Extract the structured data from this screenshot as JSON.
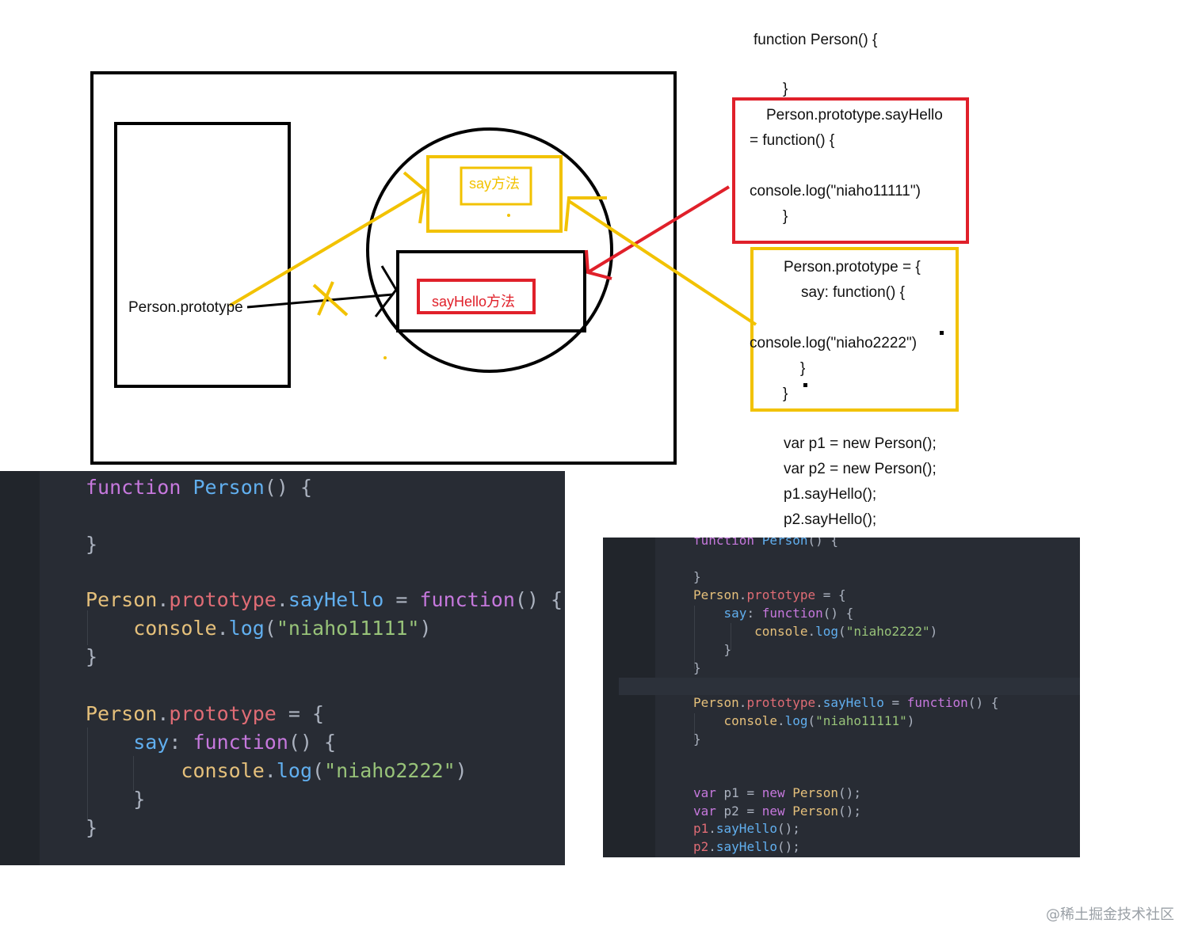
{
  "diagram": {
    "prototype_label": "Person.prototype",
    "say_method_label": "say方法",
    "sayhello_method_label": "sayHello方法"
  },
  "notes": {
    "function_decl": "function Person() {",
    "function_close": "}",
    "red_box": {
      "line1": "Person.prototype.sayHello",
      "line2": "= function() {",
      "line3": "console.log(\"niaho11111\")",
      "line4": "}"
    },
    "yellow_box": {
      "line1": "Person.prototype = {",
      "line2": "say: function() {",
      "line3": "console.log(\"niaho2222\")",
      "line4": "}",
      "line5": "}"
    },
    "calls": [
      "var p1 = new Person();",
      "var p2 = new Person();",
      "p1.sayHello();",
      "p2.sayHello();"
    ]
  },
  "code_left": {
    "lines": [
      [
        {
          "t": "function",
          "c": "kw"
        },
        {
          "t": " ",
          "c": "pun"
        },
        {
          "t": "Person",
          "c": "fn"
        },
        {
          "t": "() {",
          "c": "pun"
        }
      ],
      [
        {
          "t": "}",
          "c": "pun"
        }
      ],
      [
        {
          "t": "Person",
          "c": "obj"
        },
        {
          "t": ".",
          "c": "pun"
        },
        {
          "t": "prototype",
          "c": "prop"
        },
        {
          "t": ".",
          "c": "pun"
        },
        {
          "t": "sayHello",
          "c": "fn"
        },
        {
          "t": " = ",
          "c": "pun"
        },
        {
          "t": "function",
          "c": "kw"
        },
        {
          "t": "() {",
          "c": "pun"
        }
      ],
      [
        {
          "t": "    console",
          "c": "obj"
        },
        {
          "t": ".",
          "c": "pun"
        },
        {
          "t": "log",
          "c": "fn"
        },
        {
          "t": "(",
          "c": "pun"
        },
        {
          "t": "\"niaho11111\"",
          "c": "str"
        },
        {
          "t": ")",
          "c": "pun"
        }
      ],
      [
        {
          "t": "}",
          "c": "pun"
        }
      ],
      [
        {
          "t": "Person",
          "c": "obj"
        },
        {
          "t": ".",
          "c": "pun"
        },
        {
          "t": "prototype",
          "c": "prop"
        },
        {
          "t": " = {",
          "c": "pun"
        }
      ],
      [
        {
          "t": "    say",
          "c": "fn"
        },
        {
          "t": ": ",
          "c": "pun"
        },
        {
          "t": "function",
          "c": "kw"
        },
        {
          "t": "() {",
          "c": "pun"
        }
      ],
      [
        {
          "t": "        console",
          "c": "obj"
        },
        {
          "t": ".",
          "c": "pun"
        },
        {
          "t": "log",
          "c": "fn"
        },
        {
          "t": "(",
          "c": "pun"
        },
        {
          "t": "\"niaho2222\"",
          "c": "str"
        },
        {
          "t": ")",
          "c": "pun"
        }
      ],
      [
        {
          "t": "    }",
          "c": "pun"
        }
      ],
      [
        {
          "t": "}",
          "c": "pun"
        }
      ]
    ]
  },
  "code_right": {
    "lines": [
      [
        {
          "t": "function",
          "c": "kw"
        },
        {
          "t": " ",
          "c": "pun"
        },
        {
          "t": "Person",
          "c": "fn"
        },
        {
          "t": "() {",
          "c": "pun"
        }
      ],
      [
        {
          "t": "}",
          "c": "pun"
        }
      ],
      [
        {
          "t": "Person",
          "c": "obj"
        },
        {
          "t": ".",
          "c": "pun"
        },
        {
          "t": "prototype",
          "c": "prop"
        },
        {
          "t": " = {",
          "c": "pun"
        }
      ],
      [
        {
          "t": "    say",
          "c": "fn"
        },
        {
          "t": ": ",
          "c": "pun"
        },
        {
          "t": "function",
          "c": "kw"
        },
        {
          "t": "() {",
          "c": "pun"
        }
      ],
      [
        {
          "t": "        console",
          "c": "obj"
        },
        {
          "t": ".",
          "c": "pun"
        },
        {
          "t": "log",
          "c": "fn"
        },
        {
          "t": "(",
          "c": "pun"
        },
        {
          "t": "\"niaho2222\"",
          "c": "str"
        },
        {
          "t": ")",
          "c": "pun"
        }
      ],
      [
        {
          "t": "    }",
          "c": "pun"
        }
      ],
      [
        {
          "t": "}",
          "c": "pun"
        }
      ],
      [
        {
          "t": "Person",
          "c": "obj"
        },
        {
          "t": ".",
          "c": "pun"
        },
        {
          "t": "prototype",
          "c": "prop"
        },
        {
          "t": ".",
          "c": "pun"
        },
        {
          "t": "sayHello",
          "c": "fn"
        },
        {
          "t": " = ",
          "c": "pun"
        },
        {
          "t": "function",
          "c": "kw"
        },
        {
          "t": "() {",
          "c": "pun"
        }
      ],
      [
        {
          "t": "    console",
          "c": "obj"
        },
        {
          "t": ".",
          "c": "pun"
        },
        {
          "t": "log",
          "c": "fn"
        },
        {
          "t": "(",
          "c": "pun"
        },
        {
          "t": "\"niaho11111\"",
          "c": "str"
        },
        {
          "t": ")",
          "c": "pun"
        }
      ],
      [
        {
          "t": "}",
          "c": "pun"
        }
      ],
      [
        {
          "t": "var",
          "c": "kw"
        },
        {
          "t": " p1 = ",
          "c": "pun"
        },
        {
          "t": "new",
          "c": "kw"
        },
        {
          "t": " ",
          "c": "pun"
        },
        {
          "t": "Person",
          "c": "obj"
        },
        {
          "t": "();",
          "c": "pun"
        }
      ],
      [
        {
          "t": "var",
          "c": "kw"
        },
        {
          "t": " p2 = ",
          "c": "pun"
        },
        {
          "t": "new",
          "c": "kw"
        },
        {
          "t": " ",
          "c": "pun"
        },
        {
          "t": "Person",
          "c": "obj"
        },
        {
          "t": "();",
          "c": "pun"
        }
      ],
      [
        {
          "t": "p1",
          "c": "prop"
        },
        {
          "t": ".",
          "c": "pun"
        },
        {
          "t": "sayHello",
          "c": "fn"
        },
        {
          "t": "();",
          "c": "pun"
        }
      ],
      [
        {
          "t": "p2",
          "c": "prop"
        },
        {
          "t": ".",
          "c": "pun"
        },
        {
          "t": "sayHello",
          "c": "fn"
        },
        {
          "t": "();",
          "c": "pun"
        }
      ]
    ]
  },
  "watermark": "@稀土掘金技术社区",
  "colors": {
    "yellow": "#f2c200",
    "red": "#e0202a",
    "code_bg": "#282c34"
  }
}
